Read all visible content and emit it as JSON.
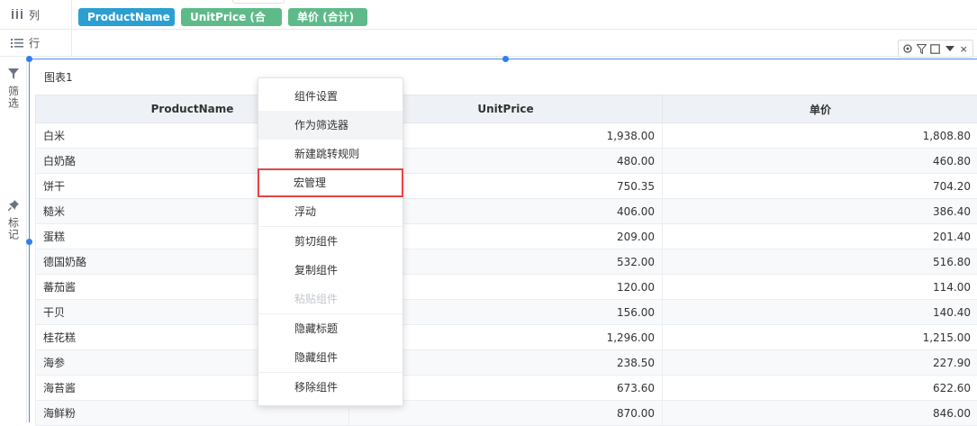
{
  "shelves": {
    "columns": {
      "label": "列",
      "icon": "columns-icon",
      "pills": [
        {
          "label": "ProductName",
          "color": "#2c9fd2"
        },
        {
          "label": "UnitPrice (合计)",
          "color": "#5fba8a"
        },
        {
          "label": "单价 (合计)",
          "color": "#5fba8a"
        }
      ]
    },
    "rows": {
      "label": "行",
      "icon": "rows-icon"
    }
  },
  "rail": {
    "filter": {
      "label": "筛选",
      "icon": "filter-icon"
    },
    "mark": {
      "label": "标记",
      "icon": "pin-icon"
    }
  },
  "widget": {
    "title": "图表1",
    "toolbar": [
      "settings-icon",
      "filter-icon",
      "maximize-icon",
      "dropdown-icon",
      "close-icon"
    ],
    "toolbar_close": "×"
  },
  "table": {
    "headers": [
      "ProductName",
      "UnitPrice",
      "单价"
    ],
    "rows": [
      [
        "白米",
        "1,938.00",
        "1,808.80"
      ],
      [
        "白奶酪",
        "480.00",
        "460.80"
      ],
      [
        "饼干",
        "750.35",
        "704.20"
      ],
      [
        "糙米",
        "406.00",
        "386.40"
      ],
      [
        "蛋糕",
        "209.00",
        "201.40"
      ],
      [
        "德国奶酪",
        "532.00",
        "516.80"
      ],
      [
        "蕃茄酱",
        "120.00",
        "114.00"
      ],
      [
        "干贝",
        "156.00",
        "140.40"
      ],
      [
        "桂花糕",
        "1,296.00",
        "1,215.00"
      ],
      [
        "海参",
        "238.50",
        "227.90"
      ],
      [
        "海苔酱",
        "673.60",
        "622.60"
      ],
      [
        "海鲜粉",
        "870.00",
        "846.00"
      ]
    ]
  },
  "context_menu": {
    "items": [
      {
        "label": "组件设置"
      },
      {
        "label": "作为筛选器"
      },
      {
        "label": "新建跳转规则"
      },
      {
        "label": "宏管理"
      },
      {
        "label": "浮动"
      },
      {
        "label": "剪切组件"
      },
      {
        "label": "复制组件"
      },
      {
        "label": "粘贴组件"
      },
      {
        "label": "隐藏标题"
      },
      {
        "label": "隐藏组件"
      },
      {
        "label": "移除组件"
      }
    ],
    "highlighted": "作为筛选器",
    "boxed": "宏管理",
    "disabled": "粘贴组件"
  }
}
